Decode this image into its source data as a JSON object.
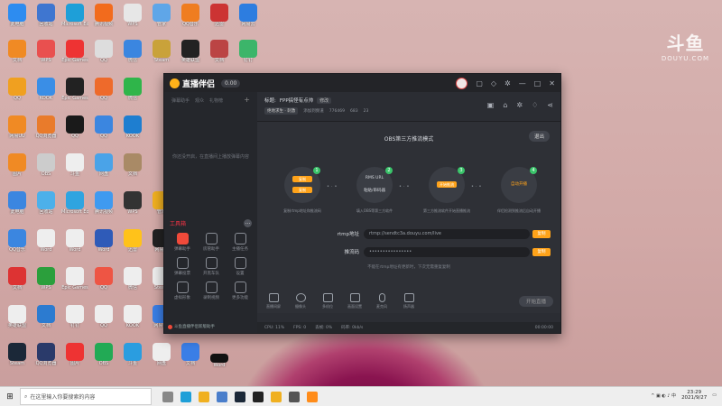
{
  "watermark": {
    "brand": "斗鱼",
    "domain": "DOUYU.COM"
  },
  "app": {
    "brand": "直播伴侣",
    "version_badge": "0.00",
    "sidebar": {
      "tabs": [
        "弹幕助手",
        "观众",
        "礼物榜"
      ],
      "empty_text": "你还没开启，在直播间上播放弹幕内容",
      "tools_title": "工具箱",
      "tools": [
        {
          "label": "弹幕助手",
          "icon": "danmaku-icon",
          "hot": true
        },
        {
          "label": "房管助手",
          "icon": "user-icon",
          "hot": false
        },
        {
          "label": "主播任务",
          "icon": "task-icon",
          "hot": false
        },
        {
          "label": "弹幕投票",
          "icon": "vote-icon",
          "hot": false
        },
        {
          "label": "开黑车队",
          "icon": "download-icon",
          "hot": false
        },
        {
          "label": "设置",
          "icon": "image-icon",
          "hot": false
        },
        {
          "label": "虚拟形象",
          "icon": "avatar-icon",
          "hot": false
        },
        {
          "label": "录制视频",
          "icon": "record-icon",
          "hot": false
        },
        {
          "label": "更多功能",
          "icon": "more-icon",
          "hot": false
        }
      ],
      "footer_text": "斗鱼直播伴侣新版助手"
    },
    "info": {
      "title_label": "标题:",
      "title_value": "FPP搞怪有点帅",
      "edit": "修改",
      "category": "绝地求生 · 刺激",
      "follow": "添加到频道",
      "fans": "776469",
      "hot": "683",
      "online": "23"
    },
    "obs": {
      "title": "OBS第三方推流模式",
      "exit": "退出",
      "steps": [
        {
          "num": "1",
          "btn1": "复制",
          "btn2": "复制",
          "caption": "复制rtmp地址和推流码"
        },
        {
          "num": "2",
          "top": "RMS URL",
          "bottom": "粘贴/串码器",
          "caption": "填入OBS等第三方软件"
        },
        {
          "num": "3",
          "btn1": "开始推流",
          "caption": "第三方推流软件开始直播推流"
        },
        {
          "num": "4",
          "plain": "自动开播",
          "caption": "伴侣检测到推流后自动开播"
        }
      ],
      "rtmp_label": "rtmp地址",
      "rtmp_value": "rtmp://sendtc3a.douyu.com/live",
      "key_label": "推流码",
      "key_value": "••••••••••••••••",
      "copy": "复制",
      "hint": "不能在rtmp地址有更新时，下次无需重复复制"
    },
    "toolbar": {
      "items": [
        "直播间屏",
        "摄像头",
        "多机位",
        "画面设置",
        "麦克风",
        "扬声器"
      ],
      "go_live": "开始直播"
    },
    "statusbar": {
      "items": [
        "CPU: 11%",
        "FPS: 0",
        "丢帧: 0%",
        "码率: 0kb/s"
      ],
      "right": "00:00:00"
    }
  },
  "taskbar": {
    "search_placeholder": "在这里输入你要搜索的内容",
    "time": "23:29",
    "date": "2021/9/27"
  },
  "desktop": {
    "icons": [
      "此电脑",
      "回收站",
      "Microsoft Edge",
      "腾讯视频",
      "WPS",
      "管家",
      "QQ音乐",
      "迅雷",
      "网易云",
      "文档",
      "WPS",
      "Epic Games",
      "QQ",
      "微信",
      "Steam",
      "英雄联盟",
      "文档",
      "钉钉",
      "QQ",
      "KOOK",
      "网易UU",
      "QQ浏览器",
      "图片",
      "OBS",
      "斗鱼",
      "网盘",
      "文档",
      "Word"
    ]
  }
}
